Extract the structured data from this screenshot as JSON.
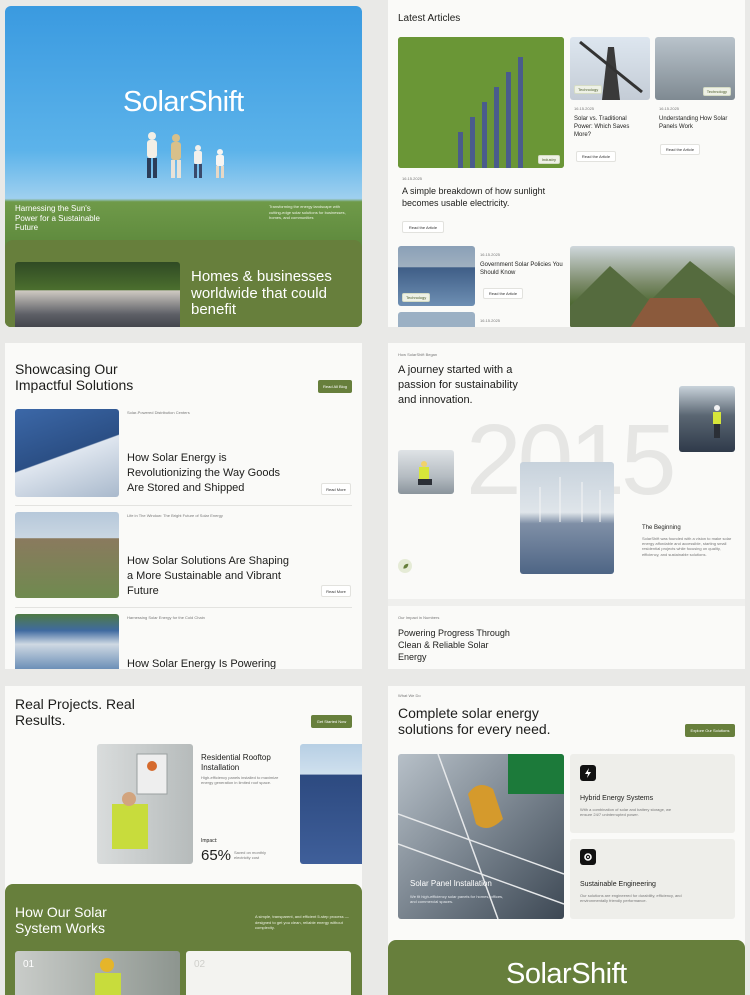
{
  "hero": {
    "brand": "SolarShift",
    "tagline": "Harnessing the Sun's Power for a Sustainable Future",
    "desc": "Transforming the energy landscape with cutting-edge solar solutions for businesses, homes, and communities",
    "benefit": "Homes & businesses worldwide that could benefit"
  },
  "articles": {
    "heading": "Latest Articles",
    "main": {
      "tag": "Industry",
      "date": "16.15.2025",
      "title": "A simple breakdown of how sunlight becomes usable electricity.",
      "button": "Read the Article"
    },
    "a1": {
      "tag": "Technology",
      "date": "16.15.2025",
      "title": "Solar vs. Traditional Power: Which Saves More?",
      "button": "Read the Article"
    },
    "a2": {
      "tag": "Technology",
      "date": "16.15.2025",
      "title": "Understanding How Solar Panels Work",
      "button": "Read the Article"
    },
    "a3": {
      "tag": "Technology",
      "date": "16.15.2025",
      "title": "Government Solar Policies You Should Know",
      "button": "Read the Article"
    },
    "a4": {
      "date": "16.15.2025"
    }
  },
  "solutions": {
    "heading": "Showcasing Our Impactful Solutions",
    "blog_button": "Read All Blog",
    "items": [
      {
        "kicker": "Solar-Powered Distribution Centers",
        "title": "How Solar Energy is Revolutionizing the Way Goods Are Stored and Shipped",
        "button": "Read More"
      },
      {
        "kicker": "Life in The Window: The Bright Future of Solar Energy",
        "title": "How Solar Solutions Are Shaping a More Sustainable and Vibrant Future",
        "button": "Read More"
      },
      {
        "kicker": "Harnessing Solar Energy for the Cold Chain",
        "title": "How Solar Energy Is Powering"
      }
    ]
  },
  "journey": {
    "kicker": "How SolarShift Began",
    "heading": "A journey started with a passion for sustainability and innovation.",
    "year": "2015",
    "beginning_title": "The Beginning",
    "beginning_text": "SolarShift was founded with a vision to make solar energy affordable and accessible, starting small residential projects while focusing on quality, efficiency, and sustainable solutions.",
    "impact_kicker": "Our Impact in Numbers",
    "impact_heading": "Powering Progress Through Clean & Reliable Solar Energy"
  },
  "projects": {
    "heading": "Real Projects. Real Results.",
    "button": "Get Started Now",
    "card_title": "Residential Rooftop Installation",
    "card_desc": "High-efficiency panels installed to maximize energy generation in limited roof space.",
    "impact_label": "Impact:",
    "impact_value": "65%",
    "impact_desc": "Saved on monthly electricity cost"
  },
  "howitworks": {
    "heading": "How Our Solar System Works",
    "desc": "A simple, transparent, and efficient 5-step process — designed to get you clean, reliable energy without complexity.",
    "step1": "01",
    "step2": "02"
  },
  "whatwedo": {
    "kicker": "What We Do",
    "heading": "Complete solar energy solutions for every need.",
    "button": "Explore Our Solutions",
    "install_title": "Solar Panel Installation",
    "install_desc": "We fit high-efficiency solar panels for homes, offices, and commercial spaces.",
    "hybrid_title": "Hybrid Energy Systems",
    "hybrid_desc": "With a combination of solar and battery storage, we ensure 24/7 uninterrupted power.",
    "eng_title": "Sustainable Engineering",
    "eng_desc": "Our solutions are engineered for durability, efficiency, and environmentally friendly performance."
  },
  "footer": {
    "brand": "SolarShift"
  },
  "colors": {
    "accent": "#677f3c",
    "background": "#e9e9e7",
    "card": "#fafaf8"
  }
}
